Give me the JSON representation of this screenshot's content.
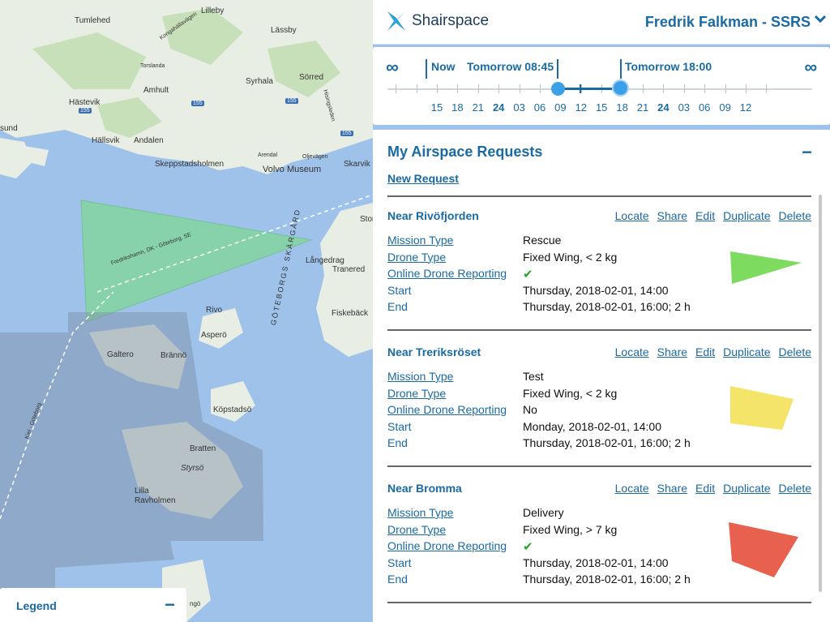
{
  "app": {
    "name": "Shairspace",
    "user": "Fredrik Falkman - SSRS"
  },
  "timeline": {
    "left_symbol": "∞",
    "right_symbol": "∞",
    "now_label": "Now",
    "start_label": "Tomorrow 08:45",
    "end_label": "Tomorrow 18:00",
    "hours": [
      "15",
      "18",
      "21",
      "24",
      "03",
      "06",
      "09",
      "12",
      "15",
      "18",
      "21",
      "24",
      "03",
      "06",
      "09",
      "12"
    ],
    "bold_hours": [
      "24"
    ]
  },
  "requests_panel": {
    "title": "My Airspace Requests",
    "collapse_symbol": "−",
    "new_request": "New Request",
    "field_labels": {
      "mission_type": "Mission Type",
      "drone_type": "Drone Type",
      "online_reporting": "Online Drone Reporting",
      "start": "Start",
      "end": "End"
    },
    "actions": [
      "Locate",
      "Share",
      "Edit",
      "Duplicate",
      "Delete"
    ],
    "requests": [
      {
        "name": "Near Rivöfjorden",
        "mission_type": "Rescue",
        "drone_type": "Fixed Wing, < 2 kg",
        "online_reporting": "✔",
        "start": "Thursday, 2018-02-01, 14:00",
        "end": "Thursday, 2018-02-01, 16:00; 2 h",
        "color": "#7ddc5f"
      },
      {
        "name": "Near Treriksröset",
        "mission_type": "Test",
        "drone_type": "Fixed Wing, < 2 kg",
        "online_reporting": "No",
        "start": "Monday, 2018-02-01, 14:00",
        "end": "Thursday, 2018-02-01, 16:00; 2 h",
        "color": "#f4e46a"
      },
      {
        "name": "Near Bromma",
        "mission_type": "Delivery",
        "drone_type": "Fixed Wing, > 7 kg",
        "online_reporting": "✔",
        "start": "Thursday, 2018-02-01, 14:00",
        "end": "Thursday, 2018-02-01, 16:00; 2 h",
        "color": "#e8604e"
      }
    ]
  },
  "legend": {
    "title": "Legend",
    "toggle_symbol": "−"
  },
  "map": {
    "places": [
      "Tumlehed",
      "Lilleby",
      "Lässby",
      "Torslanda",
      "Syrhala",
      "Sörred",
      "Hästevik",
      "Amhult",
      "Hällsvik",
      "Andalen",
      "Skeppstadsholmen",
      "Volvo Museum",
      "Skarvik",
      "Arendal",
      "Oljevägen",
      "Fredrikshamn, DK - Göteborg, SE",
      "Långedrag",
      "Tranered",
      "Rivo",
      "Asperö",
      "Fiskebäck",
      "Galtero",
      "Brännö",
      "Köpstadsö",
      "Bratten",
      "Styrsö",
      "Lilla Ravholmen",
      "GÖTEBORGS SKÄRGÅRD",
      "Kiel - Göteborg",
      "Kongahällavägen",
      "Hisingsleden",
      "sund",
      "Stor",
      "ngö"
    ],
    "road_numbers": [
      "155",
      "155",
      "155",
      "155"
    ],
    "colors": {
      "water": "#9ec2ea",
      "land": "#e9efe4",
      "restricted": "#7d8ca3"
    }
  }
}
